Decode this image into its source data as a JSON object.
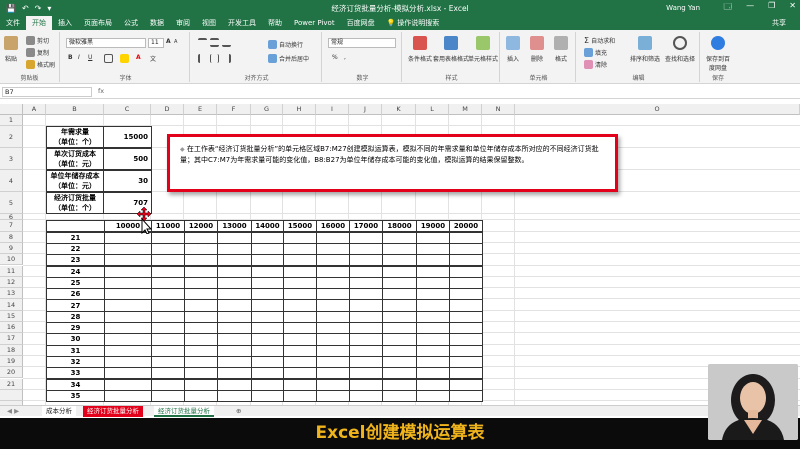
{
  "title_bar": {
    "title": "经济订货批量分析-模拟分析.xlsx - Excel",
    "user": "Wang Yan",
    "quick_access": [
      "💾",
      "↶",
      "↷",
      "▾"
    ],
    "window_controls": [
      "🗔",
      "—",
      "❐",
      "✕"
    ]
  },
  "menu_tabs": [
    "文件",
    "开始",
    "插入",
    "页面布局",
    "公式",
    "数据",
    "审阅",
    "视图",
    "开发工具",
    "帮助",
    "Power Pivot",
    "百度网盘",
    "💡",
    "操作说明搜索"
  ],
  "share": "共享",
  "ribbon": {
    "clipboard": {
      "paste": "粘贴",
      "cut": "剪切",
      "copy": "复制",
      "format_painter": "格式刷",
      "label": "剪贴板"
    },
    "font": {
      "name": "微软雅黑",
      "size": "11",
      "label": "字体",
      "buttons": [
        "B",
        "I",
        "U"
      ],
      "grow": "A",
      "shrink": "A",
      "wen": "文"
    },
    "alignment": {
      "wrap": "自动换行",
      "merge": "合并后居中",
      "label": "对齐方式"
    },
    "number": {
      "format": "常规",
      "label": "数字",
      "symbols": [
        "%",
        ","
      ]
    },
    "styles": {
      "conditional": "条件格式",
      "table": "套用表格格式",
      "cell": "单元格样式",
      "label": "样式"
    },
    "cells": {
      "insert": "插入",
      "delete": "删除",
      "format": "格式",
      "label": "单元格"
    },
    "editing": {
      "autosum": "自动求和",
      "fill": "填充",
      "clear": "清除",
      "sort": "排序和筛选",
      "find": "查找和选择",
      "label": "编辑"
    },
    "save": {
      "button": "保存到百度网盘",
      "label": "保存"
    }
  },
  "formula_bar": {
    "name_box": "B7",
    "fx": "fx"
  },
  "columns": [
    "A",
    "B",
    "C",
    "D",
    "E",
    "F",
    "G",
    "H",
    "I",
    "J",
    "K",
    "L",
    "M",
    "N",
    "O"
  ],
  "rows": [
    "1",
    "2",
    "3",
    "4",
    "5",
    "6",
    "7",
    "8",
    "9",
    "10",
    "11",
    "12",
    "13",
    "14",
    "15",
    "16",
    "17",
    "18",
    "19",
    "20",
    "21"
  ],
  "params": [
    {
      "label1": "年需求量",
      "label2": "（单位：个）",
      "value": "15000"
    },
    {
      "label1": "单次订货成本",
      "label2": "（单位：元）",
      "value": "500"
    },
    {
      "label1": "单位年储存成本",
      "label2": "（单位：元）",
      "value": "30"
    },
    {
      "label1": "经济订货批量",
      "label2": "（单位：个）",
      "value": "707"
    }
  ],
  "table": {
    "col_headers": [
      "10000",
      "11000",
      "12000",
      "13000",
      "14000",
      "15000",
      "16000",
      "17000",
      "18000",
      "19000",
      "20000"
    ],
    "row_headers": [
      "21",
      "22",
      "23",
      "24",
      "25",
      "26",
      "27",
      "28",
      "29",
      "30",
      "31",
      "32",
      "33",
      "34",
      "35"
    ]
  },
  "instruction": "在工作表“经济订货批量分析”的单元格区域B7:M27创建模拟运算表，模拟不同的年需求量和单位年储存成本所对应的不同经济订货批量；其中C7:M7为年需求量可能的变化值，B8:B27为单位年储存成本可能的变化值，模拟运算的结果保留整数。",
  "sheet_tabs": [
    "成本分析",
    "经济订货批量分析",
    "经济订货批量分析",
    "⊕"
  ],
  "caption": "Excel创建模拟运算表",
  "colors": {
    "excel_green": "#217346",
    "callout_border": "#e2001a",
    "caption_text": "#f0b41c"
  }
}
